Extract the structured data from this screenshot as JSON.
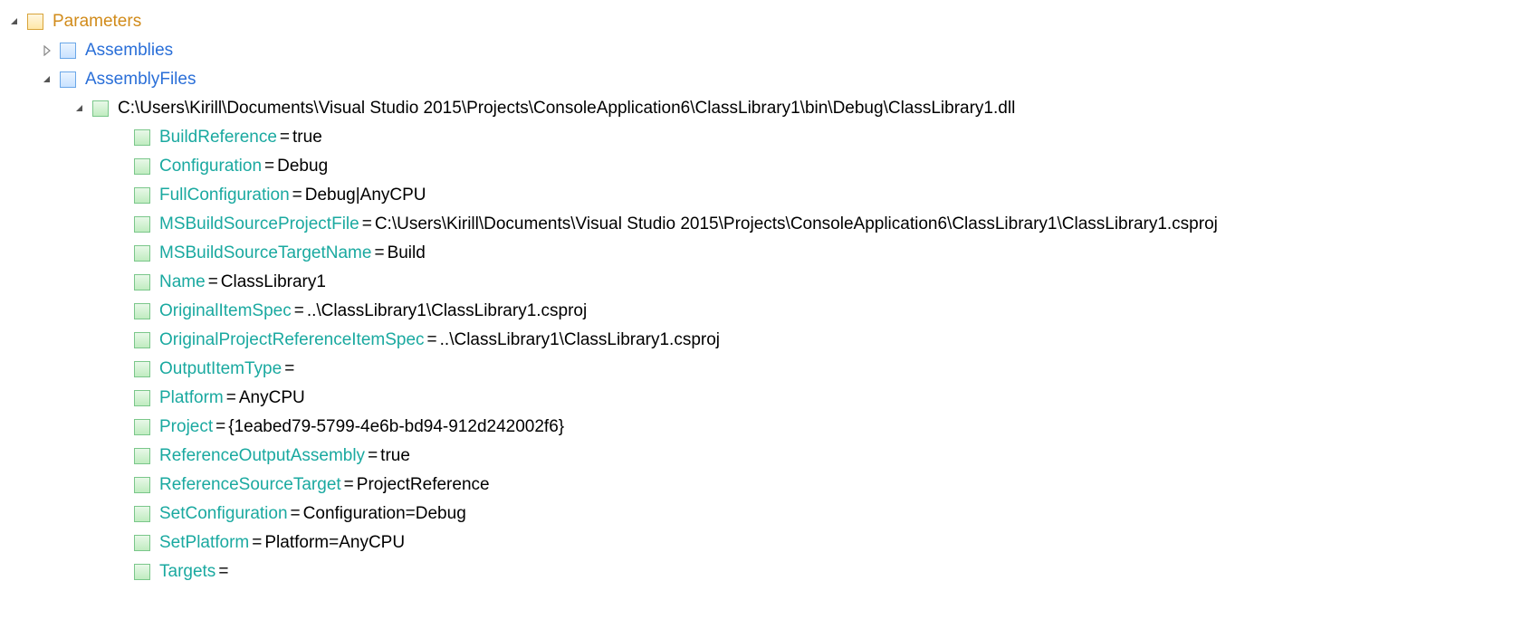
{
  "root": {
    "label": "Parameters"
  },
  "children": [
    {
      "label": "Assemblies"
    },
    {
      "label": "AssemblyFiles"
    }
  ],
  "filePath": "C:\\Users\\Kirill\\Documents\\Visual Studio 2015\\Projects\\ConsoleApplication6\\ClassLibrary1\\bin\\Debug\\ClassLibrary1.dll",
  "props": [
    {
      "key": "BuildReference",
      "val": "true"
    },
    {
      "key": "Configuration",
      "val": "Debug"
    },
    {
      "key": "FullConfiguration",
      "val": "Debug|AnyCPU"
    },
    {
      "key": "MSBuildSourceProjectFile",
      "val": "C:\\Users\\Kirill\\Documents\\Visual Studio 2015\\Projects\\ConsoleApplication6\\ClassLibrary1\\ClassLibrary1.csproj"
    },
    {
      "key": "MSBuildSourceTargetName",
      "val": "Build"
    },
    {
      "key": "Name",
      "val": "ClassLibrary1"
    },
    {
      "key": "OriginalItemSpec",
      "val": "..\\ClassLibrary1\\ClassLibrary1.csproj"
    },
    {
      "key": "OriginalProjectReferenceItemSpec",
      "val": "..\\ClassLibrary1\\ClassLibrary1.csproj"
    },
    {
      "key": "OutputItemType",
      "val": ""
    },
    {
      "key": "Platform",
      "val": "AnyCPU"
    },
    {
      "key": "Project",
      "val": "{1eabed79-5799-4e6b-bd94-912d242002f6}"
    },
    {
      "key": "ReferenceOutputAssembly",
      "val": "true"
    },
    {
      "key": "ReferenceSourceTarget",
      "val": "ProjectReference"
    },
    {
      "key": "SetConfiguration",
      "val": "Configuration=Debug"
    },
    {
      "key": "SetPlatform",
      "val": "Platform=AnyCPU"
    },
    {
      "key": "Targets",
      "val": ""
    }
  ]
}
